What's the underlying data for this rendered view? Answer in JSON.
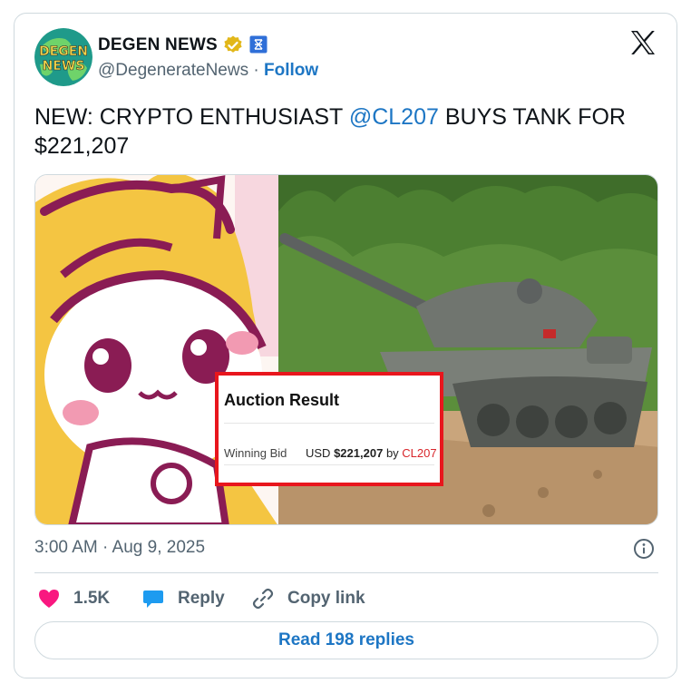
{
  "tweet": {
    "author": {
      "name": "DEGEN NEWS",
      "avatar_text_top": "DEGEN",
      "avatar_text_bottom": "NEWS",
      "handle": "@DegenerateNews",
      "separator": "·",
      "follow_label": "Follow"
    },
    "text_prefix": "NEW: CRYPTO ENTHUSIAST ",
    "mention": "@CL207",
    "text_suffix": " BUYS TANK FOR $221,207",
    "media": {
      "auction_title": "Auction Result",
      "winning_label": "Winning Bid",
      "currency": "USD",
      "amount": "$221,207",
      "by_word": "by",
      "winner": "CL207"
    },
    "timestamp": "3:00 AM · Aug 9, 2025",
    "actions": {
      "likes": "1.5K",
      "reply_label": "Reply",
      "copy_label": "Copy link"
    },
    "read_replies_label": "Read 198 replies"
  },
  "colors": {
    "accent": "#1d76c4",
    "like": "#f91880",
    "reply_icon": "#1d9bf0",
    "auction_border": "#e8161d"
  }
}
